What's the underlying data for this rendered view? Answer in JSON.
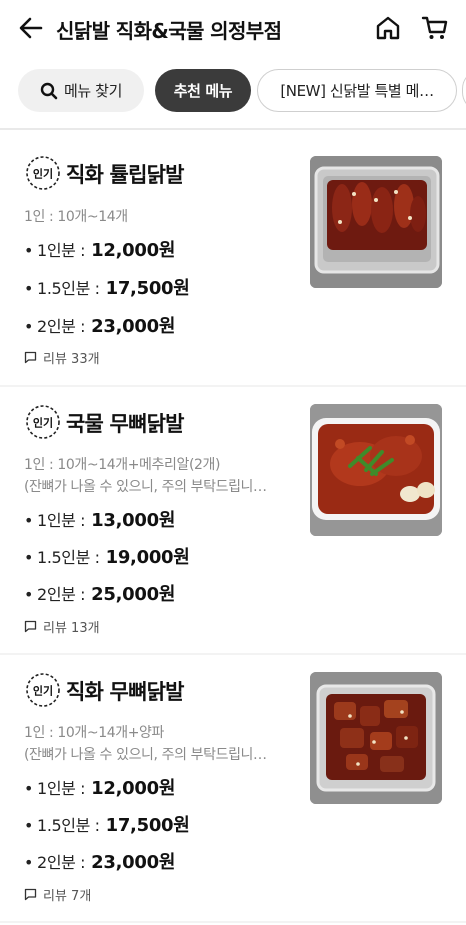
{
  "header": {
    "back_icon": "arrow-left-icon",
    "title": "신닭발 직화&국물 의정부점",
    "home_icon": "home-icon",
    "cart_icon": "cart-icon"
  },
  "chips": {
    "search_label": "메뉴 찾기",
    "search_icon": "search-icon",
    "recommend_label": "추천 메뉴",
    "special_label": "[NEW] 신닭발 특별 메…"
  },
  "colors": {
    "active_chip": "#3b3b3b",
    "inactive_chip": "#f0f0f0",
    "muted_text": "#8a8a8a"
  },
  "menu": [
    {
      "badge": "인기",
      "name": "직화 튤립닭발",
      "serving": "1인 : 10개~14개",
      "note": "",
      "options": [
        {
          "label": "1인분 :",
          "price": "12,000원"
        },
        {
          "label": "1.5인분 :",
          "price": "17,500원"
        },
        {
          "label": "2인분 :",
          "price": "23,000원"
        }
      ],
      "review": "리뷰 33개",
      "image": "grilled-tulip-chicken-feet-in-foil-tray"
    },
    {
      "badge": "인기",
      "name": "국물 무뼈닭발",
      "serving": "1인 : 10개~14개+메추리알(2개)",
      "note": "(잔뼈가 나올 수 있으니, 주의 부탁드립니…",
      "options": [
        {
          "label": "1인분 :",
          "price": "13,000원"
        },
        {
          "label": "1.5인분 :",
          "price": "19,000원"
        },
        {
          "label": "2인분 :",
          "price": "25,000원"
        }
      ],
      "review": "리뷰 13개",
      "image": "soup-boneless-chicken-feet-with-eggs"
    },
    {
      "badge": "인기",
      "name": "직화 무뼈닭발",
      "serving": "1인 : 10개~14개+양파",
      "note": "(잔뼈가 나올 수 있으니, 주의 부탁드립니…",
      "options": [
        {
          "label": "1인분 :",
          "price": "12,000원"
        },
        {
          "label": "1.5인분 :",
          "price": "17,500원"
        },
        {
          "label": "2인분 :",
          "price": "23,000원"
        }
      ],
      "review": "리뷰 7개",
      "image": "grilled-boneless-chicken-feet-in-foil-tray"
    }
  ]
}
